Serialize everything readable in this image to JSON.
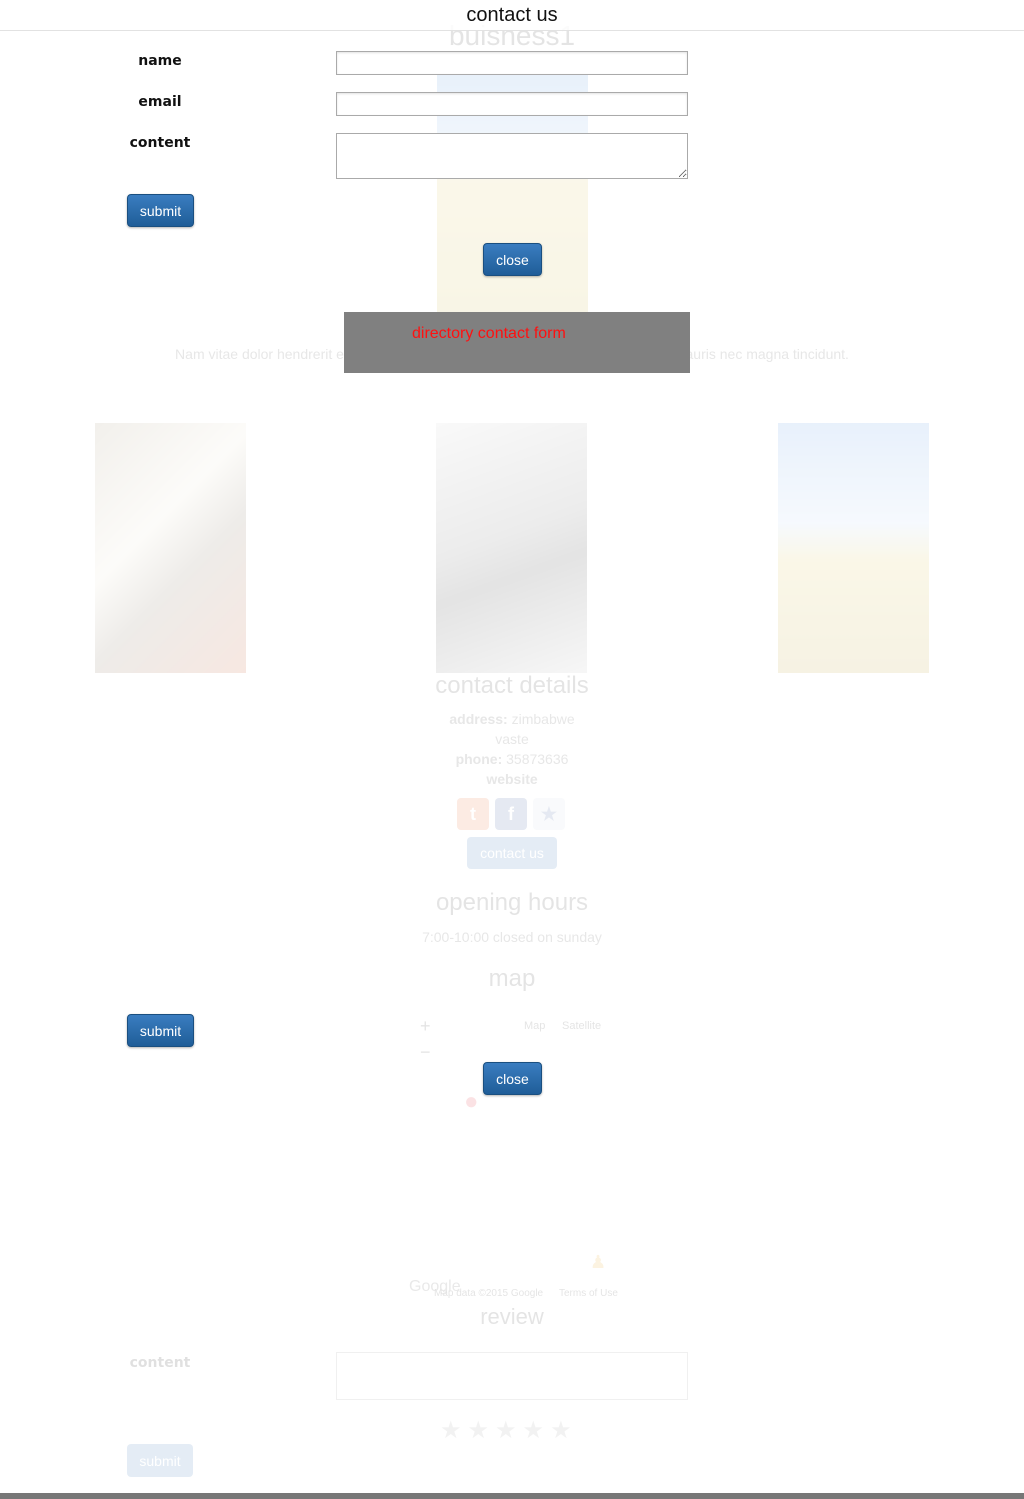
{
  "background_page": {
    "business_title": "buisness1",
    "intro_text": "Nam vitae dolor hendrerit egestas semper quis ... amet eleifend arcu adipiscing. Mauris nec magna tincidunt.",
    "contact_details": {
      "heading": "contact details",
      "address_label": "address:",
      "address_value": "zimbabwe",
      "address_line2": "vaste",
      "phone_label": "phone:",
      "phone_value": "35873636",
      "website_label": "website",
      "contact_us_button": "contact us"
    },
    "opening_hours": {
      "heading": "opening hours",
      "text": "7:00-10:00 closed on sunday"
    },
    "map": {
      "heading": "map",
      "zoom_in": "+",
      "zoom_out": "−",
      "type_map": "Map",
      "type_satellite": "Satellite",
      "attribution": "Map data ©2015 Google",
      "terms": "Terms of Use",
      "google_logo": "Google"
    },
    "review": {
      "heading": "review",
      "content_label": "content",
      "stars": "★★★★★",
      "submit_label": "submit"
    }
  },
  "contact_modal": {
    "title": "contact us",
    "fields": {
      "name_label": "name",
      "email_label": "email",
      "content_label": "content",
      "name_value": "",
      "email_value": "",
      "content_value": ""
    },
    "submit_label": "submit",
    "close_label": "close"
  },
  "duplicate_buttons": {
    "submit_label": "submit",
    "close_label": "close"
  },
  "toast": {
    "message": "directory contact form",
    "message_color": "#ff1010",
    "background": "#808080"
  },
  "colors": {
    "button_primary": "#2f6fb0"
  }
}
